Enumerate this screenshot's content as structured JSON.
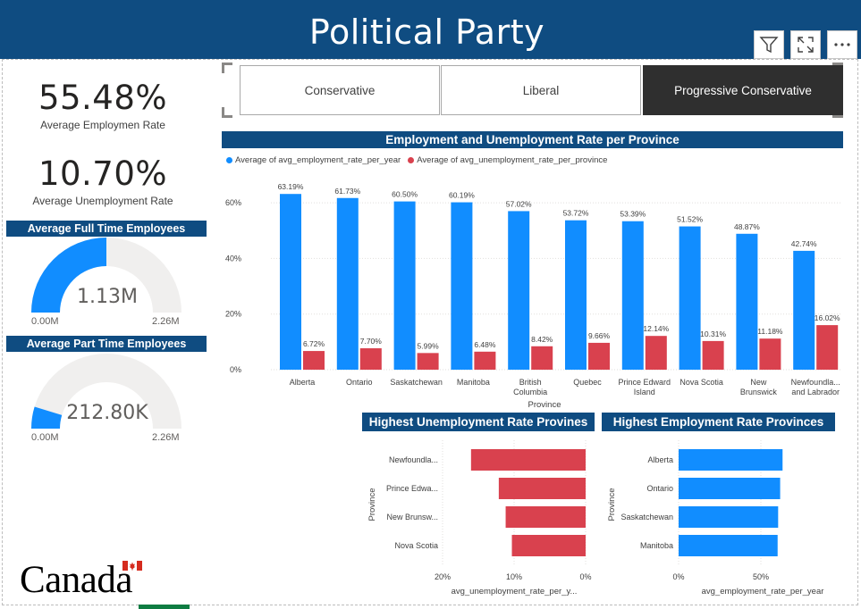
{
  "header": {
    "title": "Political Party"
  },
  "kpis": {
    "employment": {
      "value": "55.48%",
      "label": "Average Employmen Rate"
    },
    "unemployment": {
      "value": "10.70%",
      "label": "Average Unemployment Rate"
    }
  },
  "gauges": {
    "full_time": {
      "title": "Average Full Time Employees",
      "value": "1.13M",
      "min": "0.00M",
      "max": "2.26M",
      "fraction": 0.5,
      "color": "#118dff"
    },
    "part_time": {
      "title": "Average Part Time Employees",
      "value": "212.80K",
      "min": "0.00M",
      "max": "2.26M",
      "fraction": 0.094,
      "color": "#118dff"
    }
  },
  "slicer": {
    "options": [
      "Conservative",
      "Liberal",
      "Progressive Conservative"
    ],
    "selected": "Progressive Conservative"
  },
  "icons": [
    "filter-icon",
    "focus-mode-icon",
    "more-options-icon"
  ],
  "colors": {
    "brand": "#0f4c81",
    "employment": "#118dff",
    "unemployment": "#d9414e"
  },
  "logo": {
    "text": "Canada"
  },
  "chart_data": [
    {
      "type": "bar",
      "title": "Employment and Unemployment Rate per Province",
      "xlabel": "Province",
      "ylabel": "",
      "ylim": [
        0,
        70
      ],
      "yticks": [
        "0%",
        "20%",
        "40%",
        "60%"
      ],
      "legend_position": "top-left",
      "categories": [
        "Alberta",
        "Ontario",
        "Saskatchewan",
        "Manitoba",
        "British Columbia",
        "Quebec",
        "Prince Edward Island",
        "Nova Scotia",
        "New Brunswick",
        "Newfoundla... and Labrador"
      ],
      "series": [
        {
          "name": "Average of avg_employment_rate_per_year",
          "color": "#118dff",
          "values": [
            63.19,
            61.73,
            60.5,
            60.19,
            57.02,
            53.72,
            53.39,
            51.52,
            48.87,
            42.74
          ],
          "labels": [
            "63.19%",
            "61.73%",
            "60.50%",
            "60.19%",
            "57.02%",
            "53.72%",
            "53.39%",
            "51.52%",
            "48.87%",
            "42.74%"
          ]
        },
        {
          "name": "Average of avg_unemployment_rate_per_province",
          "color": "#d9414e",
          "values": [
            6.72,
            7.7,
            5.99,
            6.48,
            8.42,
            9.66,
            12.14,
            10.31,
            11.18,
            16.02
          ],
          "labels": [
            "6.72%",
            "7.70%",
            "5.99%",
            "6.48%",
            "8.42%",
            "9.66%",
            "12.14%",
            "10.31%",
            "11.18%",
            "16.02%"
          ]
        }
      ],
      "grid": true
    },
    {
      "type": "bar",
      "orientation": "horizontal",
      "title": "Highest Unemployment Rate Provines",
      "xlabel": "avg_unemployment_rate_per_y...",
      "ylabel": "Province",
      "categories": [
        "Newfoundla...",
        "Prince Edwa...",
        "New Brunsw...",
        "Nova Scotia"
      ],
      "values": [
        16.02,
        12.14,
        11.18,
        10.31
      ],
      "xlim": [
        0,
        20
      ],
      "reversed": true,
      "xticks": [
        "20%",
        "10%",
        "0%"
      ],
      "color": "#d9414e"
    },
    {
      "type": "bar",
      "orientation": "horizontal",
      "title": "Highest Employment Rate Provinces",
      "xlabel": "avg_employment_rate_per_year",
      "ylabel": "Province",
      "categories": [
        "Alberta",
        "Ontario",
        "Saskatchewan",
        "Manitoba"
      ],
      "values": [
        63.19,
        61.73,
        60.5,
        60.19
      ],
      "xlim": [
        0,
        100
      ],
      "xticks": [
        "0%",
        "50%"
      ],
      "color": "#118dff"
    }
  ]
}
